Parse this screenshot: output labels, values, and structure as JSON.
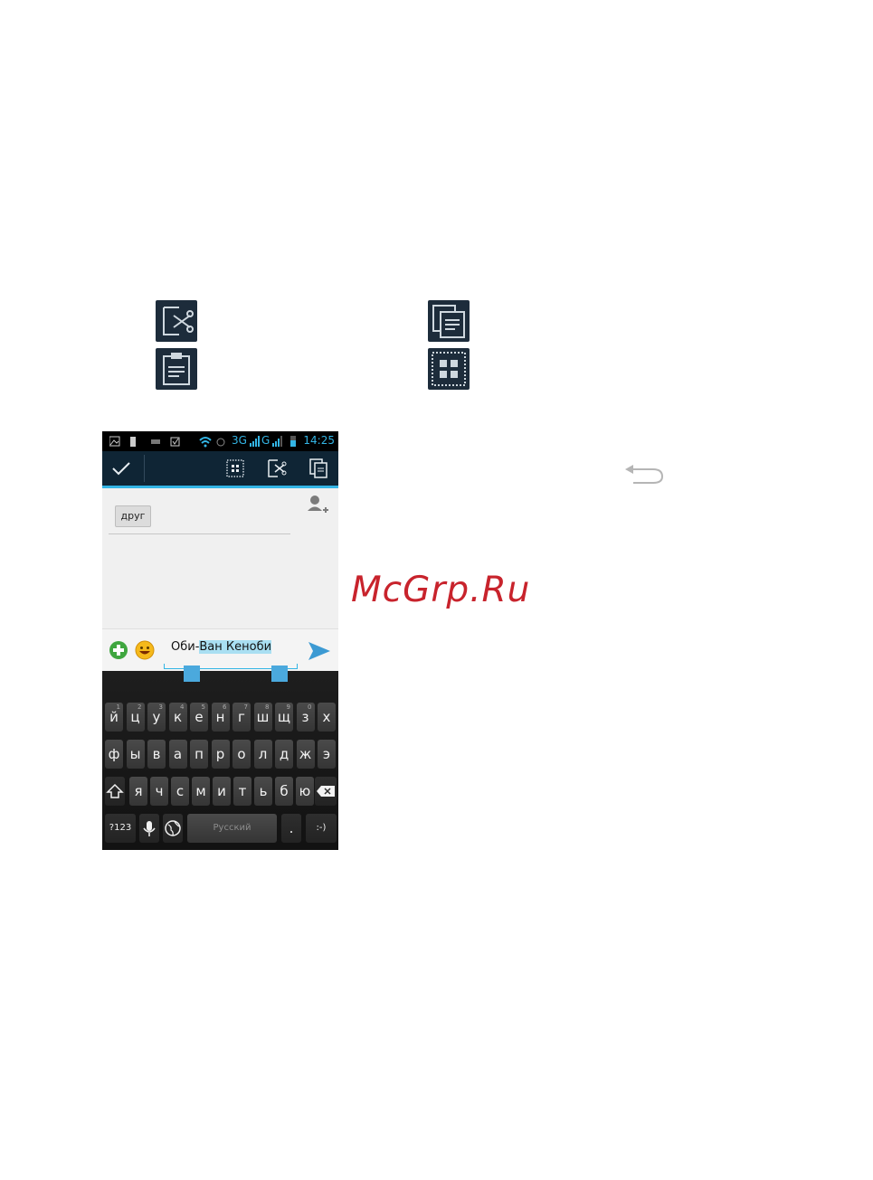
{
  "status_bar": {
    "network_3g": "3G",
    "network_g": "G",
    "time": "14:25"
  },
  "compose": {
    "recipient_chip": "друг"
  },
  "message": {
    "text_unselected": "Оби-",
    "text_selected": "Ван Кеноби"
  },
  "keyboard": {
    "row1": [
      {
        "label": "й",
        "hint": "1"
      },
      {
        "label": "ц",
        "hint": "2"
      },
      {
        "label": "у",
        "hint": "3"
      },
      {
        "label": "к",
        "hint": "4"
      },
      {
        "label": "е",
        "hint": "5"
      },
      {
        "label": "н",
        "hint": "6"
      },
      {
        "label": "г",
        "hint": "7"
      },
      {
        "label": "ш",
        "hint": "8"
      },
      {
        "label": "щ",
        "hint": "9"
      },
      {
        "label": "з",
        "hint": "0"
      },
      {
        "label": "х",
        "hint": ""
      }
    ],
    "row2": [
      "ф",
      "ы",
      "в",
      "а",
      "п",
      "р",
      "о",
      "л",
      "д",
      "ж",
      "э"
    ],
    "row3": [
      "я",
      "ч",
      "с",
      "м",
      "и",
      "т",
      "ь",
      "б",
      "ю"
    ],
    "symbols_key": "?123",
    "space_key": "Русский",
    "period_key": ".",
    "smiley_key": ":-)"
  },
  "watermark": "McGrp.Ru",
  "colors": {
    "accent": "#33b5e5",
    "actionbar": "#0f2535",
    "watermark": "#c8232c"
  },
  "icons": [
    "cut-icon",
    "copy-icon",
    "paste-icon",
    "select-all-icon",
    "back-icon"
  ]
}
